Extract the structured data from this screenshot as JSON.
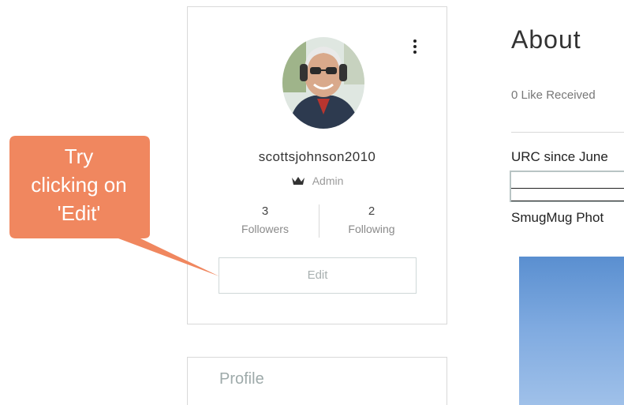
{
  "profile_card": {
    "username": "scottsjohnson2010",
    "role": "Admin",
    "role_icon": "crown-icon",
    "menu_icon": "more-vertical-icon",
    "stats": [
      {
        "value": "3",
        "label": "Followers"
      },
      {
        "value": "2",
        "label": "Following"
      }
    ],
    "edit_label": "Edit"
  },
  "profile_section": {
    "title": "Profile"
  },
  "about": {
    "title": "About",
    "likes": "0 Like Received",
    "urc_text": "URC since June",
    "smugmug_text": "SmugMug Phot"
  },
  "callout": {
    "lines": [
      "Try",
      "clicking on",
      "'Edit'"
    ],
    "color": "#f0875f"
  },
  "colors": {
    "callout": "#f0875f",
    "edit_border": "#cfd8d8",
    "card_border": "#d9d9d9"
  }
}
